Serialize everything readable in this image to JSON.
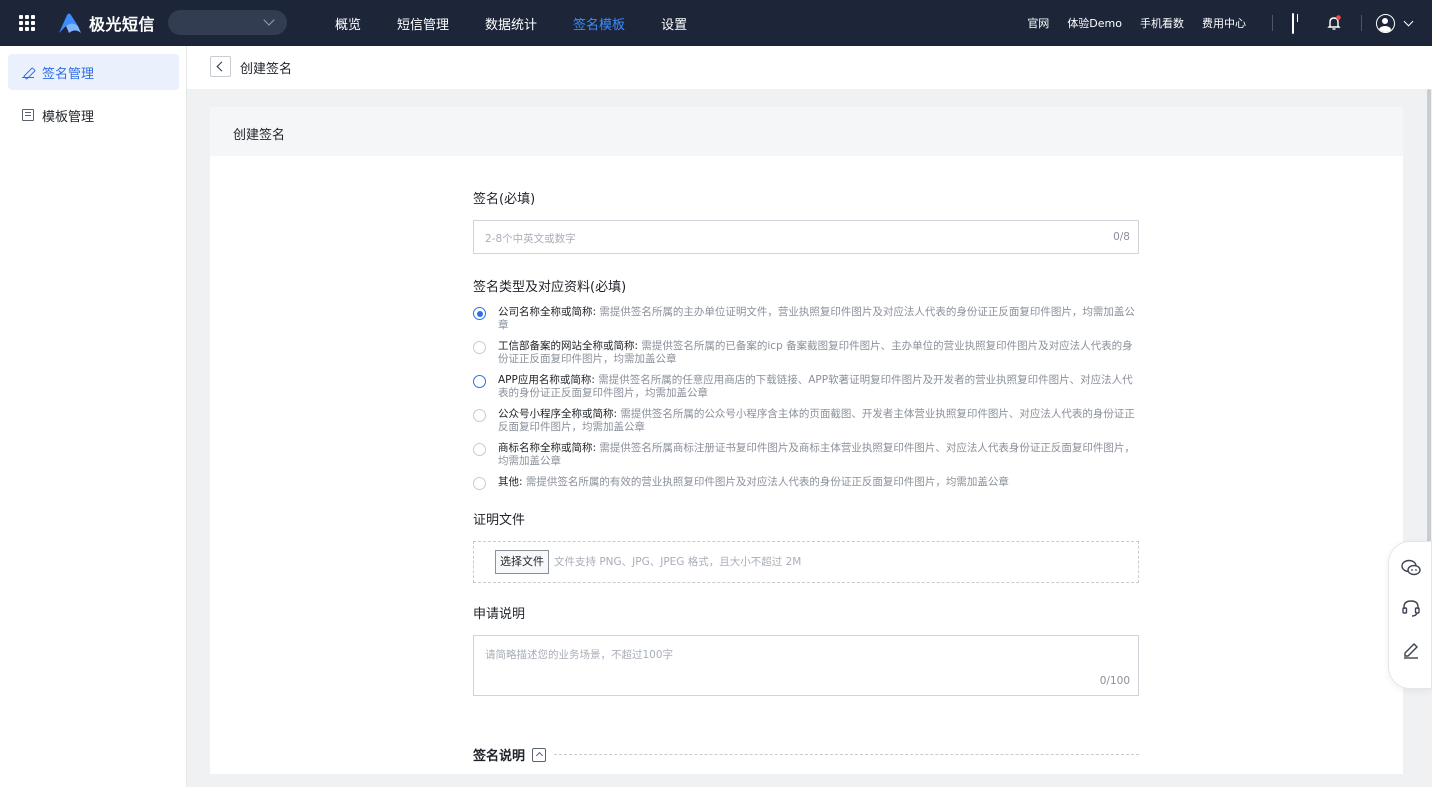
{
  "brand": {
    "name": "极光短信"
  },
  "nav": {
    "items": [
      "概览",
      "短信管理",
      "数据统计",
      "签名模板",
      "设置"
    ],
    "active_index": 3
  },
  "top_links": [
    "官网",
    "体验Demo",
    "手机看数",
    "费用中心"
  ],
  "sidebar": {
    "items": [
      {
        "label": "签名管理",
        "active": true
      },
      {
        "label": "模板管理",
        "active": false
      }
    ]
  },
  "breadcrumb": {
    "title": "创建签名"
  },
  "card": {
    "title": "创建签名"
  },
  "form": {
    "signature": {
      "label": "签名(必填)",
      "placeholder": "2-8个中英文或数字",
      "counter": "0/8"
    },
    "type": {
      "label": "签名类型及对应资料(必填)",
      "options": [
        {
          "title": "公司名称全称或简称:",
          "desc": "需提供签名所属的主办单位证明文件，营业执照复印件图片及对应法人代表的身份证正反面复印件图片，均需加盖公章",
          "selected": true
        },
        {
          "title": "工信部备案的网站全称或简称:",
          "desc": "需提供签名所属的已备案的icp 备案截图复印件图片、主办单位的营业执照复印件图片及对应法人代表的身份证正反面复印件图片，均需加盖公章",
          "selected": false
        },
        {
          "title": "APP应用名称或简称:",
          "desc": "需提供签名所属的任意应用商店的下载链接、APP软著证明复印件图片及开发者的营业执照复印件图片、对应法人代表的身份证正反面复印件图片，均需加盖公章",
          "selected": false
        },
        {
          "title": "公众号小程序全称或简称:",
          "desc": "需提供签名所属的公众号小程序含主体的页面截图、开发者主体营业执照复印件图片、对应法人代表的身份证正反面复印件图片，均需加盖公章",
          "selected": false
        },
        {
          "title": "商标名称全称或简称:",
          "desc": "需提供签名所属商标注册证书复印件图片及商标主体营业执照复印件图片、对应法人代表身份证正反面复印件图片，均需加盖公章",
          "selected": false
        },
        {
          "title": "其他:",
          "desc": "需提供签名所属的有效的营业执照复印件图片及对应法人代表的身份证正反面复印件图片，均需加盖公章",
          "selected": false
        }
      ]
    },
    "proof": {
      "label": "证明文件",
      "button": "选择文件",
      "hint": "文件支持 PNG、JPG、JPEG 格式，且大小不超过 2M"
    },
    "description": {
      "label": "申请说明",
      "placeholder": "请简略描述您的业务场景，不超过100字",
      "counter": "0/100"
    },
    "note": {
      "label": "签名说明"
    }
  },
  "colors": {
    "topbar": "#1c2638",
    "accent": "#2f6ee6",
    "nav_active": "#3b8cff"
  }
}
